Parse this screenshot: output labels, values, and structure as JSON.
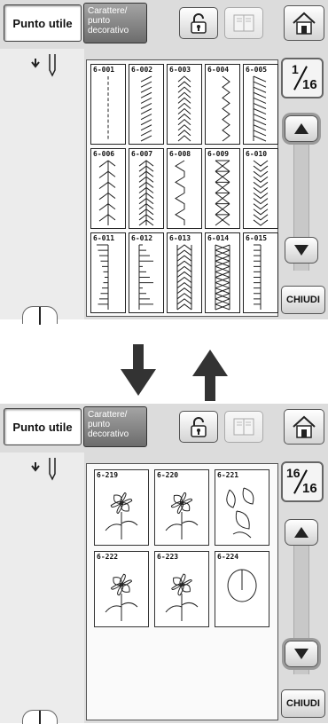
{
  "top_screen": {
    "tab_utility": "Punto utile",
    "tab_decorative": [
      "Carattere/",
      "punto",
      "decorativo"
    ],
    "page_current": "1",
    "page_total": "16",
    "close_label": "CHIUDI",
    "stitches": [
      {
        "num": "6-001",
        "pattern": "straight"
      },
      {
        "num": "6-002",
        "pattern": "slant"
      },
      {
        "num": "6-003",
        "pattern": "chevron-up"
      },
      {
        "num": "6-004",
        "pattern": "zigzag-vert"
      },
      {
        "num": "6-005",
        "pattern": "ladder-diag"
      },
      {
        "num": "6-006",
        "pattern": "feather-left"
      },
      {
        "num": "6-007",
        "pattern": "herringbone"
      },
      {
        "num": "6-008",
        "pattern": "wave-zigzag"
      },
      {
        "num": "6-009",
        "pattern": "cross-x"
      },
      {
        "num": "6-010",
        "pattern": "chevron-stack"
      },
      {
        "num": "6-011",
        "pattern": "blanket-left"
      },
      {
        "num": "6-012",
        "pattern": "blanket-steps"
      },
      {
        "num": "6-013",
        "pattern": "chevron-band"
      },
      {
        "num": "6-014",
        "pattern": "double-chevron"
      },
      {
        "num": "6-015",
        "pattern": "comb"
      }
    ]
  },
  "bottom_screen": {
    "tab_utility": "Punto utile",
    "tab_decorative": [
      "Carattere/",
      "punto",
      "decorativo"
    ],
    "page_current": "16",
    "page_total": "16",
    "close_label": "CHIUDI",
    "stitches": [
      {
        "num": "6-219",
        "pattern": "floral-1"
      },
      {
        "num": "6-220",
        "pattern": "floral-2"
      },
      {
        "num": "6-221",
        "pattern": "leaves"
      },
      {
        "num": "6-222",
        "pattern": "floral-3"
      },
      {
        "num": "6-223",
        "pattern": "floral-4"
      },
      {
        "num": "6-224",
        "pattern": "circle"
      }
    ]
  },
  "icons": {
    "lock": "lock-icon",
    "book": "book-icon",
    "home": "home-icon",
    "arrow_down": "arrow-down-icon",
    "arrow_up": "arrow-up-icon"
  }
}
